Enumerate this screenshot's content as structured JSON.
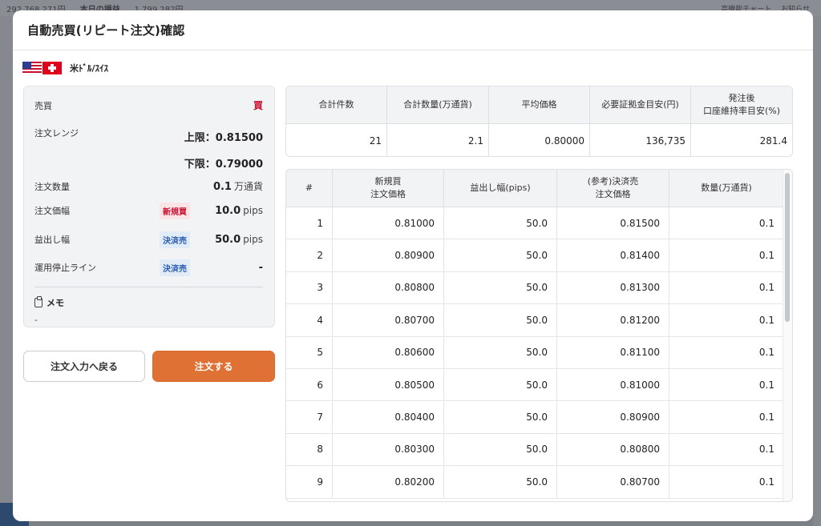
{
  "background": {
    "topbar_left_1": "292,768,271円",
    "topbar_left_2": "本日の損益",
    "topbar_left_3": "1,799,282円",
    "topbar_right_1": "高機能チャート",
    "topbar_right_2": "お知らせ"
  },
  "modal": {
    "title": "自動売買(リピート注文)確認",
    "pair": {
      "name": "米ﾄﾞﾙ/ｽｲｽ",
      "flag_base": "us-flag-icon",
      "flag_quote": "ch-flag-icon"
    }
  },
  "summary": {
    "side_label": "売買",
    "side_value": "買",
    "range_label": "注文レンジ",
    "range_upper": "上限：0.81500",
    "range_lower": "下限：0.79000",
    "qty_label": "注文数量",
    "qty_value": "0.1",
    "qty_unit": "万通貨",
    "width_label": "注文価幅",
    "width_badge": "新規買",
    "width_value": "10.0",
    "width_unit": "pips",
    "tp_label": "益出し幅",
    "tp_badge": "決済売",
    "tp_value": "50.0",
    "tp_unit": "pips",
    "stop_label": "運用停止ライン",
    "stop_badge": "決済売",
    "stop_value": "-",
    "memo_label": "メモ",
    "memo_value": "-"
  },
  "buttons": {
    "back_label": "注文入力へ戻る",
    "order_label": "注文する"
  },
  "totals": {
    "headers": [
      "合計件数",
      "合計数量(万通貨)",
      "平均価格",
      "必要証拠金目安(円)",
      "発注後\n口座維持率目安(%)"
    ],
    "values": [
      "21",
      "2.1",
      "0.80000",
      "136,735",
      "281.4"
    ]
  },
  "details": {
    "headers": [
      "#",
      "新規買\n注文価格",
      "益出し幅(pips)",
      "(参考)決済売\n注文価格",
      "数量(万通貨)"
    ],
    "rows": [
      [
        "1",
        "0.81000",
        "50.0",
        "0.81500",
        "0.1"
      ],
      [
        "2",
        "0.80900",
        "50.0",
        "0.81400",
        "0.1"
      ],
      [
        "3",
        "0.80800",
        "50.0",
        "0.81300",
        "0.1"
      ],
      [
        "4",
        "0.80700",
        "50.0",
        "0.81200",
        "0.1"
      ],
      [
        "5",
        "0.80600",
        "50.0",
        "0.81100",
        "0.1"
      ],
      [
        "6",
        "0.80500",
        "50.0",
        "0.81000",
        "0.1"
      ],
      [
        "7",
        "0.80400",
        "50.0",
        "0.80900",
        "0.1"
      ],
      [
        "8",
        "0.80300",
        "50.0",
        "0.80800",
        "0.1"
      ],
      [
        "9",
        "0.80200",
        "50.0",
        "0.80700",
        "0.1"
      ]
    ]
  },
  "colors": {
    "accent_orange": "#e07134",
    "buy_red": "#c8102e",
    "settle_blue": "#2a5db0"
  }
}
